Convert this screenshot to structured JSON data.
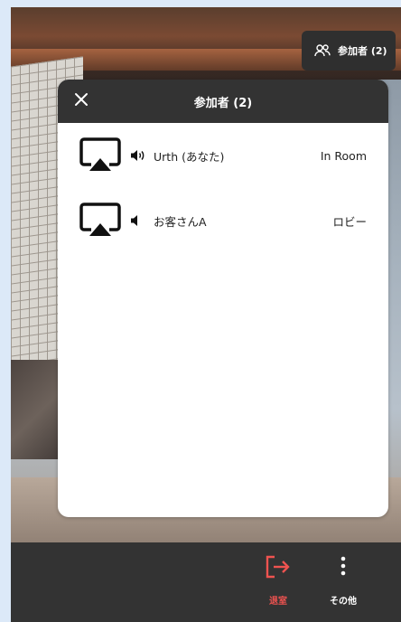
{
  "chip": {
    "label": "参加者 (2)",
    "icon": "people-icon"
  },
  "panel": {
    "title": "参加者 (2)",
    "close_icon": "close-icon",
    "participants": [
      {
        "name": "Urth (あなた)",
        "status": "In Room",
        "audio": "speaker-on"
      },
      {
        "name": "お客さんA",
        "status": "ロビー",
        "audio": "speaker-muted"
      }
    ]
  },
  "toolbar": {
    "leave_label": "退室",
    "more_label": "その他",
    "leave_color": "#ef5350"
  }
}
